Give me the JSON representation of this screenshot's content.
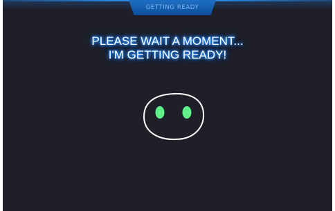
{
  "header": {
    "tab_label": "GETTING READY"
  },
  "main": {
    "message_line1": "PLEASE WAIT A MOMENT...",
    "message_line2": "I'M GETTING READY!"
  },
  "icons": {
    "face": "robot-face-icon"
  },
  "colors": {
    "background": "#1e1f29",
    "tab": "#1566bd",
    "text_glow": "#2a8cff",
    "eyes": "#5ff08a",
    "face_outline": "#ffffff"
  }
}
